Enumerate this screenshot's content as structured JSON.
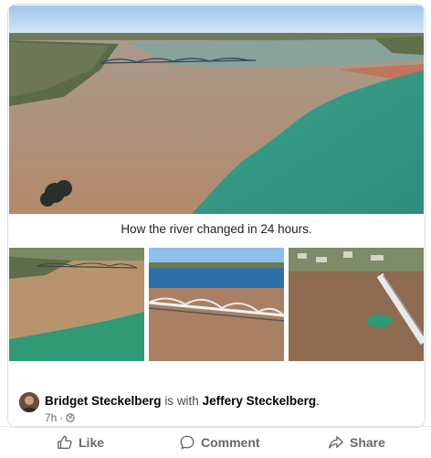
{
  "post": {
    "caption": "How the river changed in 24 hours.",
    "author": "Bridget Steckelberg",
    "with_text": "is with",
    "tagged": "Jeffery Steckelberg",
    "tagged_suffix": ".",
    "time": "7h",
    "audience_icon": "globe-icon"
  },
  "actions": {
    "like": "Like",
    "comment": "Comment",
    "share": "Share"
  },
  "colors": {
    "muddy_water": "#b0896a",
    "green_water": "#3f9e8a",
    "sky": "#cfe3f3",
    "muted_text": "#65676b"
  }
}
